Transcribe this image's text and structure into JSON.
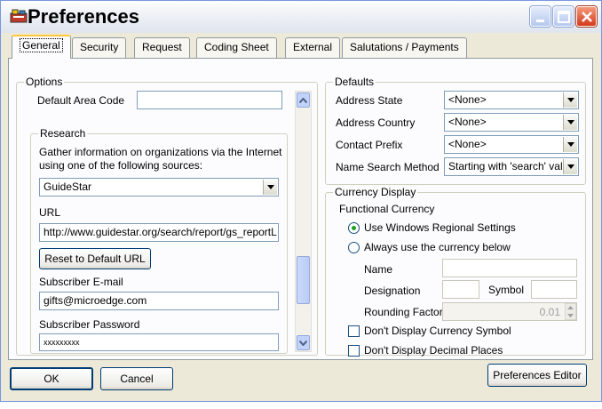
{
  "window": {
    "title": "Preferences"
  },
  "tabs": [
    {
      "label": "General"
    },
    {
      "label": "Security"
    },
    {
      "label": "Request"
    },
    {
      "label": "Coding Sheet"
    },
    {
      "label": "External"
    },
    {
      "label": "Salutations / Payments"
    }
  ],
  "options": {
    "group_label": "Options",
    "default_area_code_label": "Default Area Code",
    "default_area_code_value": "",
    "research": {
      "group_label": "Research",
      "description_line1": "Gather information on organizations via the Internet",
      "description_line2": "using one of the following sources:",
      "source_value": "GuideStar",
      "url_label": "URL",
      "url_value": "http://www.guidestar.org/search/report/gs_reportL",
      "reset_button": "Reset to Default URL",
      "email_label": "Subscriber E-mail",
      "email_value": "gifts@microedge.com",
      "password_label": "Subscriber Password",
      "password_value": "xxxxxxxxx"
    }
  },
  "defaults": {
    "group_label": "Defaults",
    "rows": [
      {
        "label": "Address State",
        "value": "<None>"
      },
      {
        "label": "Address Country",
        "value": "<None>"
      },
      {
        "label": "Contact Prefix",
        "value": "<None>"
      },
      {
        "label": "Name Search Method",
        "value": "Starting with 'search' val"
      }
    ]
  },
  "currency": {
    "group_label": "Currency Display",
    "functional_label": "Functional Currency",
    "radio_regional": "Use Windows Regional Settings",
    "radio_below": "Always use the currency below",
    "name_label": "Name",
    "designation_label": "Designation",
    "symbol_label": "Symbol",
    "rounding_label": "Rounding Factor",
    "rounding_value": "0.01",
    "check_symbol": "Don't Display Currency Symbol",
    "check_decimal": "Don't Display Decimal Places"
  },
  "footer": {
    "ok": "OK",
    "cancel": "Cancel",
    "editor": "Preferences Editor"
  }
}
